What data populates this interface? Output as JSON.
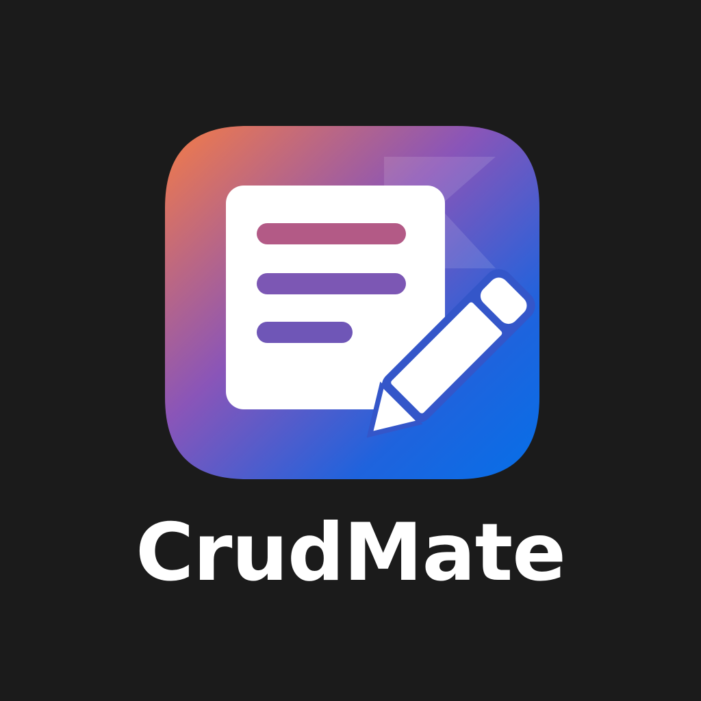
{
  "app": {
    "name": "CrudMate"
  },
  "icon": {
    "name": "document-edit-icon",
    "gradient": [
      "#f47c46",
      "#8a55b8",
      "#1f63dd",
      "#066fe8"
    ],
    "page_color": "#ffffff",
    "line_colors": [
      "#b55a8a",
      "#7a57b3",
      "#6c56b6"
    ],
    "pencil_color": "#3456c9"
  },
  "background_color": "#1b1b1b"
}
